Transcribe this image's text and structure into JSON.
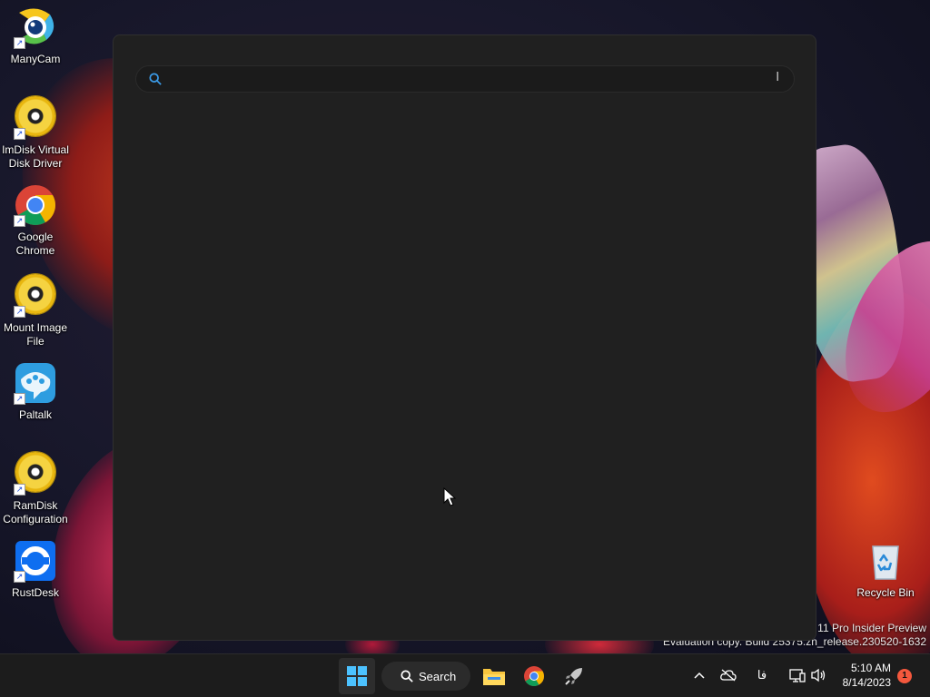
{
  "desktop": {
    "icons": [
      {
        "label": "ManyCam"
      },
      {
        "label": "ImDisk Virtual Disk Driver"
      },
      {
        "label": "Google Chrome"
      },
      {
        "label": "Mount Image File"
      },
      {
        "label": "Paltalk"
      },
      {
        "label": "RamDisk Configuration"
      },
      {
        "label": "RustDesk"
      },
      {
        "label": "Recycle Bin"
      }
    ],
    "watermark": {
      "line1": "s 11 Pro Insider Preview",
      "line2": "Evaluation copy. Build 25375.zn_release.230520-1632"
    }
  },
  "search_panel": {
    "query": "",
    "ime_indicator": "ا"
  },
  "taskbar": {
    "search_label": "Search",
    "language_indicator": "فا",
    "time": "5:10 AM",
    "date": "8/14/2023",
    "notification_count": "1"
  },
  "colors": {
    "panel_bg": "#202020",
    "taskbar_bg": "#1c1c1c",
    "accent": "#3b9be8",
    "badge": "#f4583d"
  }
}
